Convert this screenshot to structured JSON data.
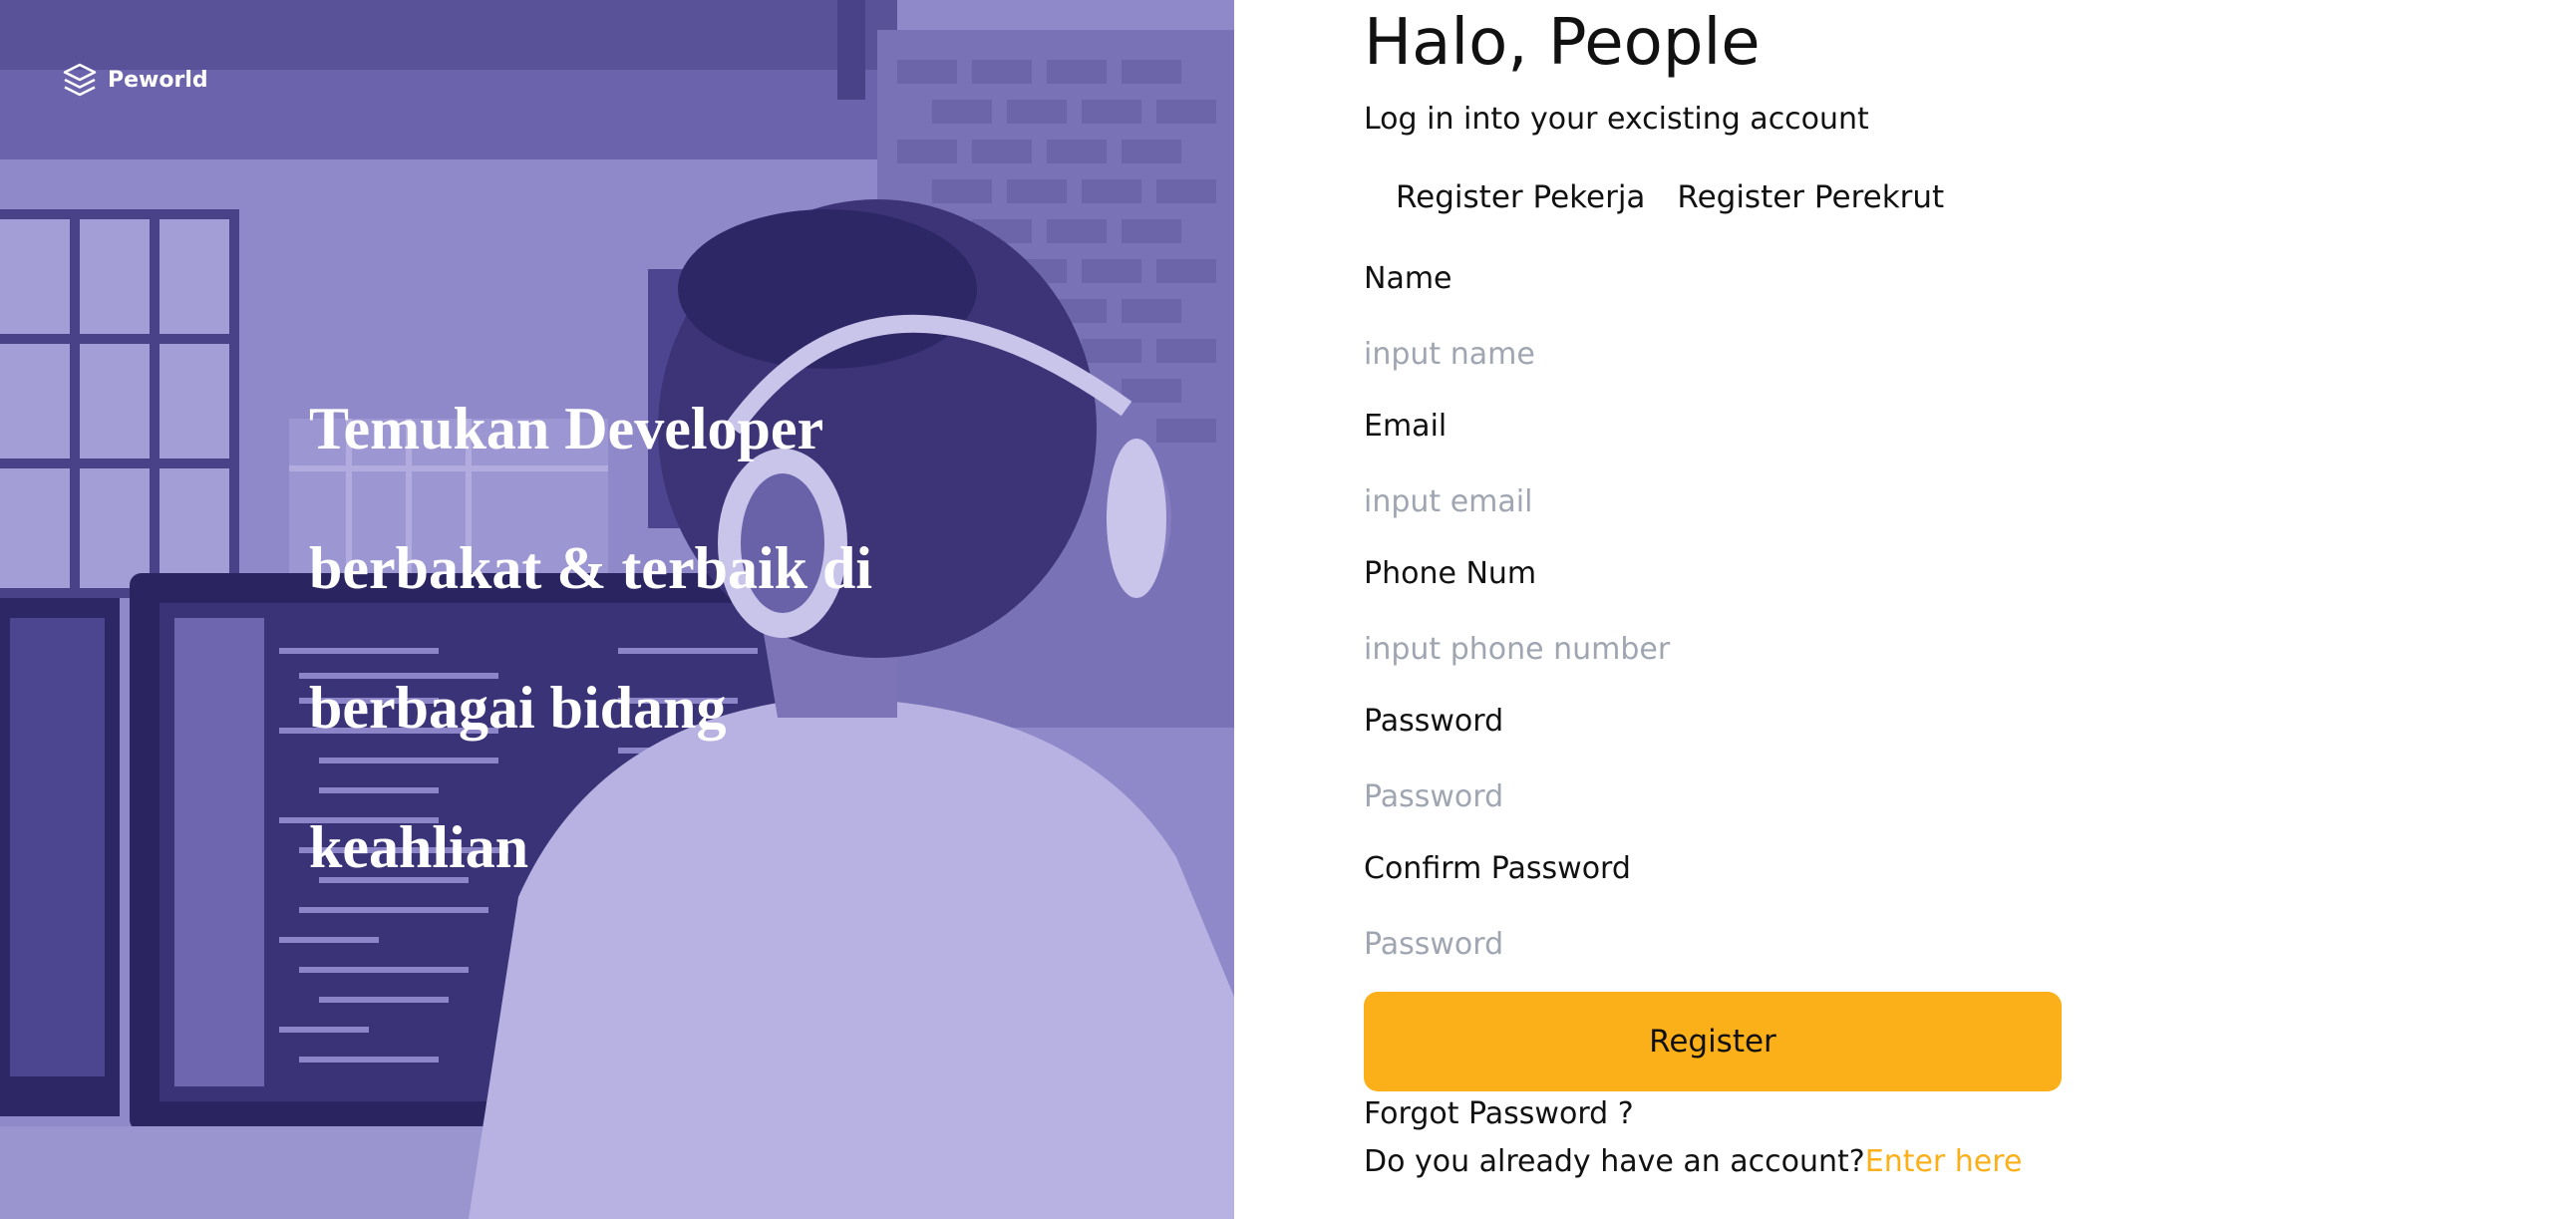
{
  "brand": {
    "name": "Peworld"
  },
  "hero": {
    "lines": [
      "Temukan Developer",
      "berbakat & terbaik di",
      "berbagai bidang",
      "keahlian"
    ]
  },
  "form": {
    "greeting": "Halo, People",
    "subtitle": "Log in into your excisting account",
    "tabs": [
      {
        "label": "Register Pekerja"
      },
      {
        "label": "Register Perekrut"
      }
    ],
    "fields": {
      "name": {
        "label": "Name",
        "placeholder": "input name",
        "value": ""
      },
      "email": {
        "label": "Email",
        "placeholder": "input email",
        "value": ""
      },
      "phone": {
        "label": "Phone Num",
        "placeholder": "input phone number",
        "value": ""
      },
      "password": {
        "label": "Password",
        "placeholder": "Password",
        "value": ""
      },
      "confirm_password": {
        "label": "Confirm Password",
        "placeholder": "Password",
        "value": ""
      }
    },
    "register_label": "Register",
    "forgot_label": "Forgot Password ?",
    "login_prompt": "Do you already have an account?",
    "login_link": "Enter here"
  },
  "colors": {
    "accent": "#fbb019",
    "hero_overlay": "#8a82c4",
    "placeholder": "#9fa6b2"
  }
}
